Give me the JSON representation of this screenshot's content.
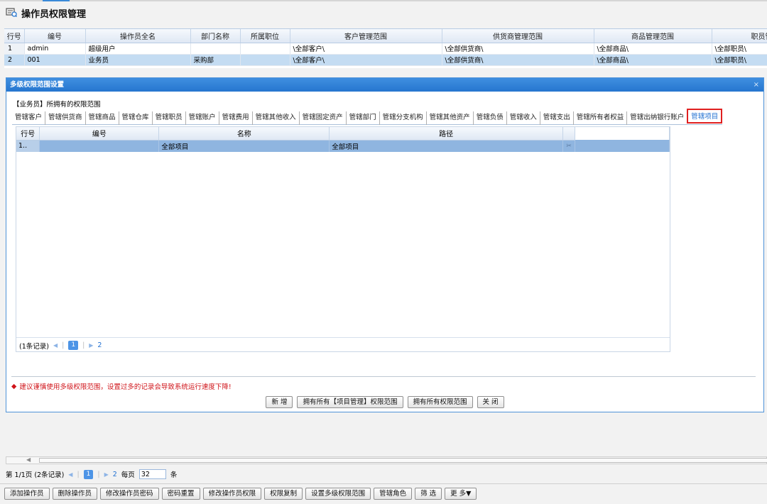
{
  "title": "操作员权限管理",
  "main_grid": {
    "columns": [
      "行号",
      "编号",
      "操作员全名",
      "部门名称",
      "所属职位",
      "客户管理范围",
      "供货商管理范围",
      "商品管理范围",
      "职员管"
    ],
    "rows": [
      [
        "1",
        "admin",
        "超级用户",
        "",
        "",
        "\\全部客户\\",
        "\\全部供货商\\",
        "\\全部商品\\",
        "\\全部职员\\"
      ],
      [
        "2",
        "001",
        "业务员",
        "采购部",
        "",
        "\\全部客户\\",
        "\\全部供货商\\",
        "\\全部商品\\",
        "\\全部职员\\"
      ]
    ]
  },
  "dialog": {
    "title": "多级权限范围设置",
    "close": "×",
    "scope_label": "【业务员】所拥有的权限范围",
    "tabs": [
      "管辖客户",
      "管辖供货商",
      "管辖商品",
      "管辖仓库",
      "管辖职员",
      "管辖账户",
      "管辖费用",
      "管辖其他收入",
      "管辖固定资产",
      "管辖部门",
      "管辖分支机构",
      "管辖其他资产",
      "管辖负债",
      "管辖收入",
      "管辖支出",
      "管辖所有者权益",
      "管辖出纳银行账户",
      "管辖项目"
    ],
    "grid": {
      "columns": [
        "行号",
        "编号",
        "名称",
        "路径"
      ],
      "rows": [
        [
          "1..",
          "",
          "全部项目",
          "全部项目"
        ]
      ],
      "cut_icon": "✂"
    },
    "pager": {
      "records": "(1条记录)",
      "page": "1",
      "total": "2"
    },
    "warning": "建议谨慎使用多级权限范围，设置过多的记录会导致系统运行速度下降!",
    "warning_icon": "◆",
    "buttons": [
      "新 增",
      "拥有所有【项目管理】权限范围",
      "拥有所有权限范围",
      "关 闭"
    ]
  },
  "pager": {
    "page_info": "第 1/1页 (2条记录)",
    "page": "1",
    "total": "2",
    "per_page_label": "每页",
    "per_page": "32",
    "unit": "条"
  },
  "bottom_buttons": [
    "添加操作员",
    "删除操作员",
    "修改操作员密码",
    "密码重置",
    "修改操作员权限",
    "权限复制",
    "设置多级权限范围",
    "管辖角色",
    "筛 选",
    "更 多▼"
  ],
  "colors": {
    "accent": "#2676cf",
    "selected_row": "#c4dcf2",
    "warning": "#d0141a",
    "active_tab_border": "#e02020"
  }
}
